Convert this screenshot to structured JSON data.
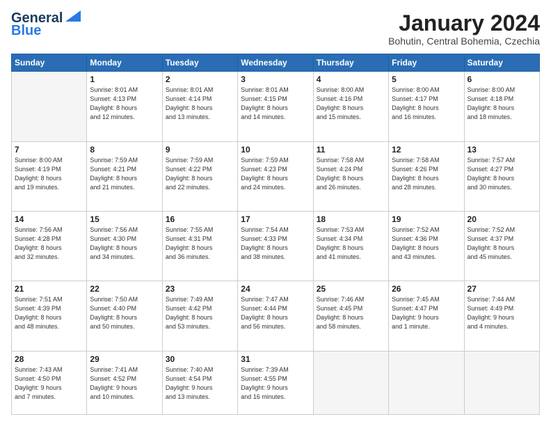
{
  "header": {
    "logo_line1": "General",
    "logo_line2": "Blue",
    "month": "January 2024",
    "location": "Bohutin, Central Bohemia, Czechia"
  },
  "weekdays": [
    "Sunday",
    "Monday",
    "Tuesday",
    "Wednesday",
    "Thursday",
    "Friday",
    "Saturday"
  ],
  "rows": [
    [
      {
        "day": "",
        "info": ""
      },
      {
        "day": "1",
        "info": "Sunrise: 8:01 AM\nSunset: 4:13 PM\nDaylight: 8 hours\nand 12 minutes."
      },
      {
        "day": "2",
        "info": "Sunrise: 8:01 AM\nSunset: 4:14 PM\nDaylight: 8 hours\nand 13 minutes."
      },
      {
        "day": "3",
        "info": "Sunrise: 8:01 AM\nSunset: 4:15 PM\nDaylight: 8 hours\nand 14 minutes."
      },
      {
        "day": "4",
        "info": "Sunrise: 8:00 AM\nSunset: 4:16 PM\nDaylight: 8 hours\nand 15 minutes."
      },
      {
        "day": "5",
        "info": "Sunrise: 8:00 AM\nSunset: 4:17 PM\nDaylight: 8 hours\nand 16 minutes."
      },
      {
        "day": "6",
        "info": "Sunrise: 8:00 AM\nSunset: 4:18 PM\nDaylight: 8 hours\nand 18 minutes."
      }
    ],
    [
      {
        "day": "7",
        "info": "Sunrise: 8:00 AM\nSunset: 4:19 PM\nDaylight: 8 hours\nand 19 minutes."
      },
      {
        "day": "8",
        "info": "Sunrise: 7:59 AM\nSunset: 4:21 PM\nDaylight: 8 hours\nand 21 minutes."
      },
      {
        "day": "9",
        "info": "Sunrise: 7:59 AM\nSunset: 4:22 PM\nDaylight: 8 hours\nand 22 minutes."
      },
      {
        "day": "10",
        "info": "Sunrise: 7:59 AM\nSunset: 4:23 PM\nDaylight: 8 hours\nand 24 minutes."
      },
      {
        "day": "11",
        "info": "Sunrise: 7:58 AM\nSunset: 4:24 PM\nDaylight: 8 hours\nand 26 minutes."
      },
      {
        "day": "12",
        "info": "Sunrise: 7:58 AM\nSunset: 4:26 PM\nDaylight: 8 hours\nand 28 minutes."
      },
      {
        "day": "13",
        "info": "Sunrise: 7:57 AM\nSunset: 4:27 PM\nDaylight: 8 hours\nand 30 minutes."
      }
    ],
    [
      {
        "day": "14",
        "info": "Sunrise: 7:56 AM\nSunset: 4:28 PM\nDaylight: 8 hours\nand 32 minutes."
      },
      {
        "day": "15",
        "info": "Sunrise: 7:56 AM\nSunset: 4:30 PM\nDaylight: 8 hours\nand 34 minutes."
      },
      {
        "day": "16",
        "info": "Sunrise: 7:55 AM\nSunset: 4:31 PM\nDaylight: 8 hours\nand 36 minutes."
      },
      {
        "day": "17",
        "info": "Sunrise: 7:54 AM\nSunset: 4:33 PM\nDaylight: 8 hours\nand 38 minutes."
      },
      {
        "day": "18",
        "info": "Sunrise: 7:53 AM\nSunset: 4:34 PM\nDaylight: 8 hours\nand 41 minutes."
      },
      {
        "day": "19",
        "info": "Sunrise: 7:52 AM\nSunset: 4:36 PM\nDaylight: 8 hours\nand 43 minutes."
      },
      {
        "day": "20",
        "info": "Sunrise: 7:52 AM\nSunset: 4:37 PM\nDaylight: 8 hours\nand 45 minutes."
      }
    ],
    [
      {
        "day": "21",
        "info": "Sunrise: 7:51 AM\nSunset: 4:39 PM\nDaylight: 8 hours\nand 48 minutes."
      },
      {
        "day": "22",
        "info": "Sunrise: 7:50 AM\nSunset: 4:40 PM\nDaylight: 8 hours\nand 50 minutes."
      },
      {
        "day": "23",
        "info": "Sunrise: 7:49 AM\nSunset: 4:42 PM\nDaylight: 8 hours\nand 53 minutes."
      },
      {
        "day": "24",
        "info": "Sunrise: 7:47 AM\nSunset: 4:44 PM\nDaylight: 8 hours\nand 56 minutes."
      },
      {
        "day": "25",
        "info": "Sunrise: 7:46 AM\nSunset: 4:45 PM\nDaylight: 8 hours\nand 58 minutes."
      },
      {
        "day": "26",
        "info": "Sunrise: 7:45 AM\nSunset: 4:47 PM\nDaylight: 9 hours\nand 1 minute."
      },
      {
        "day": "27",
        "info": "Sunrise: 7:44 AM\nSunset: 4:49 PM\nDaylight: 9 hours\nand 4 minutes."
      }
    ],
    [
      {
        "day": "28",
        "info": "Sunrise: 7:43 AM\nSunset: 4:50 PM\nDaylight: 9 hours\nand 7 minutes."
      },
      {
        "day": "29",
        "info": "Sunrise: 7:41 AM\nSunset: 4:52 PM\nDaylight: 9 hours\nand 10 minutes."
      },
      {
        "day": "30",
        "info": "Sunrise: 7:40 AM\nSunset: 4:54 PM\nDaylight: 9 hours\nand 13 minutes."
      },
      {
        "day": "31",
        "info": "Sunrise: 7:39 AM\nSunset: 4:55 PM\nDaylight: 9 hours\nand 16 minutes."
      },
      {
        "day": "",
        "info": ""
      },
      {
        "day": "",
        "info": ""
      },
      {
        "day": "",
        "info": ""
      }
    ]
  ]
}
